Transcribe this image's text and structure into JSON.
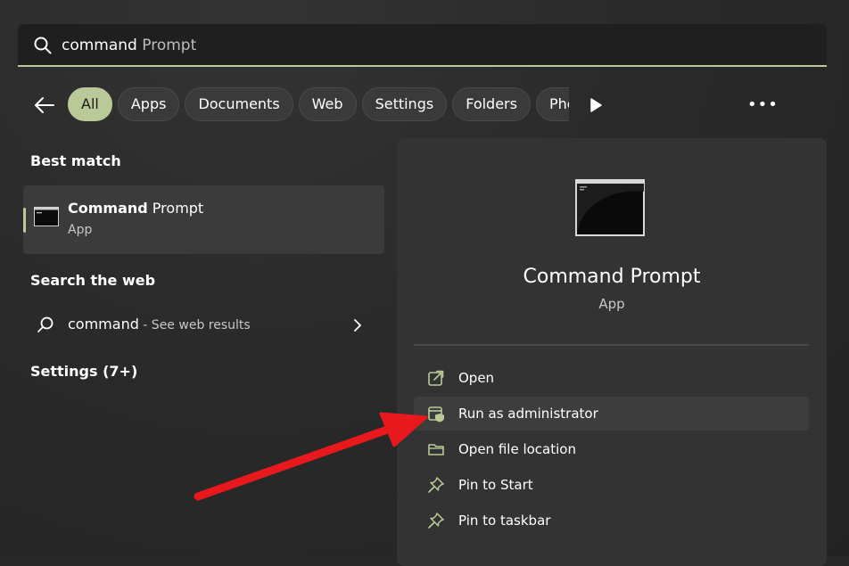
{
  "search": {
    "typed": "command",
    "suggestion": " Prompt"
  },
  "filters": {
    "tabs": [
      {
        "label": "All",
        "active": true
      },
      {
        "label": "Apps"
      },
      {
        "label": "Documents"
      },
      {
        "label": "Web"
      },
      {
        "label": "Settings"
      },
      {
        "label": "Folders"
      },
      {
        "label": "Photos"
      }
    ]
  },
  "left": {
    "best_match_heading": "Best match",
    "best_match": {
      "name_bold": "Command",
      "name_rest": " Prompt",
      "type": "App"
    },
    "web_heading": "Search the web",
    "web_result": {
      "query": "command",
      "suffix": " - See web results"
    },
    "settings_heading": "Settings (7+)"
  },
  "detail": {
    "title": "Command Prompt",
    "subtitle": "App",
    "actions": [
      {
        "label": "Open",
        "icon": "open-external-icon"
      },
      {
        "label": "Run as administrator",
        "icon": "shield-window-icon",
        "highlighted": true
      },
      {
        "label": "Open file location",
        "icon": "folder-icon"
      },
      {
        "label": "Pin to Start",
        "icon": "pin-icon"
      },
      {
        "label": "Pin to taskbar",
        "icon": "pin-icon"
      }
    ]
  },
  "colors": {
    "accent": "#b9c998",
    "annotation_arrow": "#e8191c",
    "background": "#272727",
    "panel": "#333333"
  }
}
